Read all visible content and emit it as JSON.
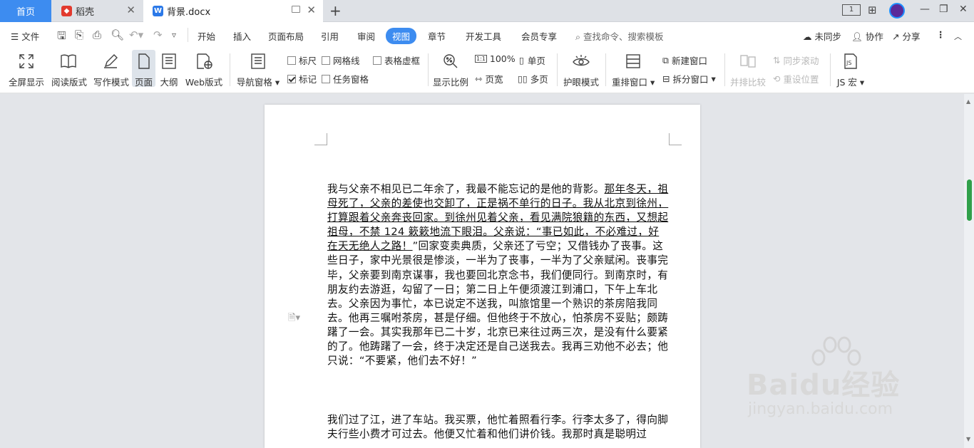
{
  "tabs": {
    "home": "首页",
    "daoke": "稻壳",
    "doc": "背景.docx"
  },
  "menu": {
    "file": "文件",
    "items": [
      "开始",
      "插入",
      "页面布局",
      "引用",
      "审阅",
      "视图",
      "章节",
      "开发工具",
      "会员专享"
    ],
    "active": "视图",
    "search": "查找命令、搜索模板",
    "sync": "未同步",
    "collab": "协作",
    "share": "分享"
  },
  "ribbon": {
    "fullscreen": "全屏显示",
    "reading": "阅读版式",
    "writing": "写作模式",
    "page": "页面",
    "outline": "大纲",
    "web": "Web版式",
    "nav_pane": "导航窗格",
    "ruler": "标尺",
    "gridlines": "网格线",
    "table_dash": "表格虚框",
    "marks": "标记",
    "task_pane": "任务窗格",
    "zoom": "显示比例",
    "zoom_100": "100%",
    "single_page": "单页",
    "page_width": "页宽",
    "multi_page": "多页",
    "eye_mode": "护眼模式",
    "rearrange": "重排窗口",
    "new_window": "新建窗口",
    "split_window": "拆分窗口",
    "side_compare": "并排比较",
    "sync_scroll": "同步滚动",
    "reset_position": "重设位置",
    "js_macro": "JS 宏"
  },
  "document": {
    "p1": [
      {
        "t": "我与父亲不相见已二年余了，我最不能忘记的是他的背影。",
        "u": false
      },
      {
        "t": "那年冬天，祖母死了，父亲的差使也交卸了，正是祸不单行的日子。我从北京到徐州，打算跟着父亲奔丧回家。到徐州见着父亲，看见满院狼籍的东西，又想起祖母，不禁 124 簌簌地流下眼泪。父亲说：“事已如此，不必难过，好在天无绝人之路！",
        "u": true
      },
      {
        "t": "”回家变卖典质，父亲还了亏空；又借钱办了丧事。这些日子，家中光景很是惨淡，一半为了丧事，一半为了父亲赋闲。丧事完毕，父亲要到南京谋事，我也要回北京念书，我们便同行。到南京时，有朋友约去游逛，勾留了一日；第二日上午便须渡江到浦口，下午上车北去。父亲因为事忙，本已说定不送我，叫旅馆里一个熟识的茶房陪我同去。他再三嘱咐茶房，甚是仔细。但他终于不放心，怕茶房不妥贴；颇踌躇了一会。其实我那年已二十岁，北京已来往过两三次，是没有什么要紧的了。他踌躇了一会，终于决定还是自己送我去。我再三劝他不必去；他只说：“不要紧，他们去不好！”",
        "u": false
      }
    ],
    "p2": "我们过了江，进了车站。我买票，他忙着照看行李。行李太多了，得向脚夫行些小费才可过去。他便又忙着和他们讲价钱。我那时真是聪明过"
  },
  "watermark": {
    "logo": "Baidu经验",
    "sub": "jingyan.baidu.com"
  }
}
